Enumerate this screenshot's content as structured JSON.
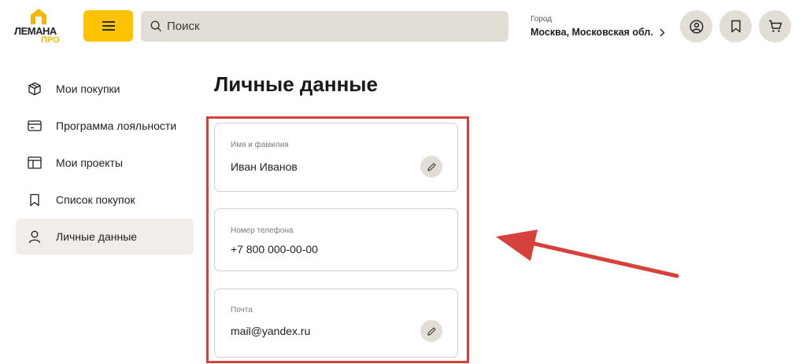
{
  "header": {
    "logo": {
      "line1": "ЛЕМАНА",
      "line2": "ПРО"
    },
    "menu_icon": "hamburger-icon",
    "search": {
      "placeholder": "Поиск",
      "icon": "search-icon"
    },
    "city": {
      "label": "Город",
      "value": "Москва, Московская обл."
    },
    "actions": [
      {
        "icon": "user-icon"
      },
      {
        "icon": "bookmark-icon"
      },
      {
        "icon": "cart-icon"
      }
    ]
  },
  "sidebar": {
    "items": [
      {
        "label": "Мои покупки",
        "icon": "box-icon",
        "active": false
      },
      {
        "label": "Программа лояльности",
        "icon": "card-icon",
        "active": false
      },
      {
        "label": "Мои проекты",
        "icon": "layout-icon",
        "active": false
      },
      {
        "label": "Список покупок",
        "icon": "bookmark-icon",
        "active": false
      },
      {
        "label": "Личные данные",
        "icon": "user-icon",
        "active": true
      }
    ]
  },
  "main": {
    "title": "Личные данные",
    "fields": [
      {
        "label": "Имя и фамилия",
        "value": "Иван Иванов",
        "editable": true
      },
      {
        "label": "Номер телефона",
        "value": "+7 800 000-00-00",
        "editable": false
      },
      {
        "label": "Почта",
        "value": "mail@yandex.ru",
        "editable": true
      }
    ]
  },
  "colors": {
    "brand_yellow": "#fdc300",
    "annotation_red": "#d6413b",
    "chip_bg": "#e2ded6",
    "active_bg": "#f1eee9"
  }
}
